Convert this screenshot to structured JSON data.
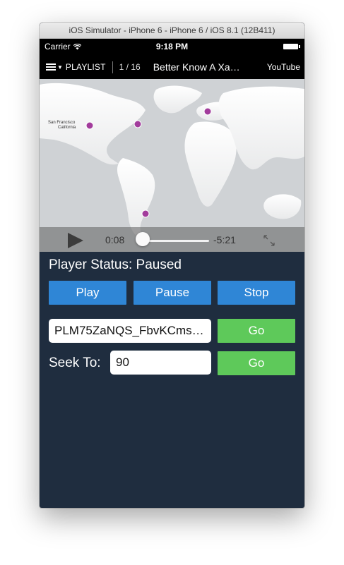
{
  "window": {
    "title": "iOS Simulator - iPhone 6 - iPhone 6 / iOS 8.1 (12B411)"
  },
  "status_bar": {
    "carrier": "Carrier",
    "time": "9:18 PM",
    "wifi_icon": "wifi-icon",
    "battery_icon": "battery-icon"
  },
  "youtube_bar": {
    "playlist_label": "PLAYLIST",
    "counter": "1 / 16",
    "video_title": "Better Know A Xa…",
    "logo": "YouTube"
  },
  "video": {
    "map_label_line1": "San Francisco",
    "map_label_line2": "California",
    "elapsed": "0:08",
    "remaining": "-5:21",
    "progress": 0.025
  },
  "player": {
    "status_text": "Player Status: Paused",
    "play_label": "Play",
    "pause_label": "Pause",
    "stop_label": "Stop",
    "playlist_field_value": "PLM75ZaNQS_FbvKCmsj…",
    "playlist_go_label": "Go",
    "seek_label": "Seek To:",
    "seek_field_value": "90",
    "seek_go_label": "Go"
  },
  "colors": {
    "background": "#1f2d3f",
    "blue_button": "#2f86d6",
    "green_button": "#5ec95a"
  }
}
